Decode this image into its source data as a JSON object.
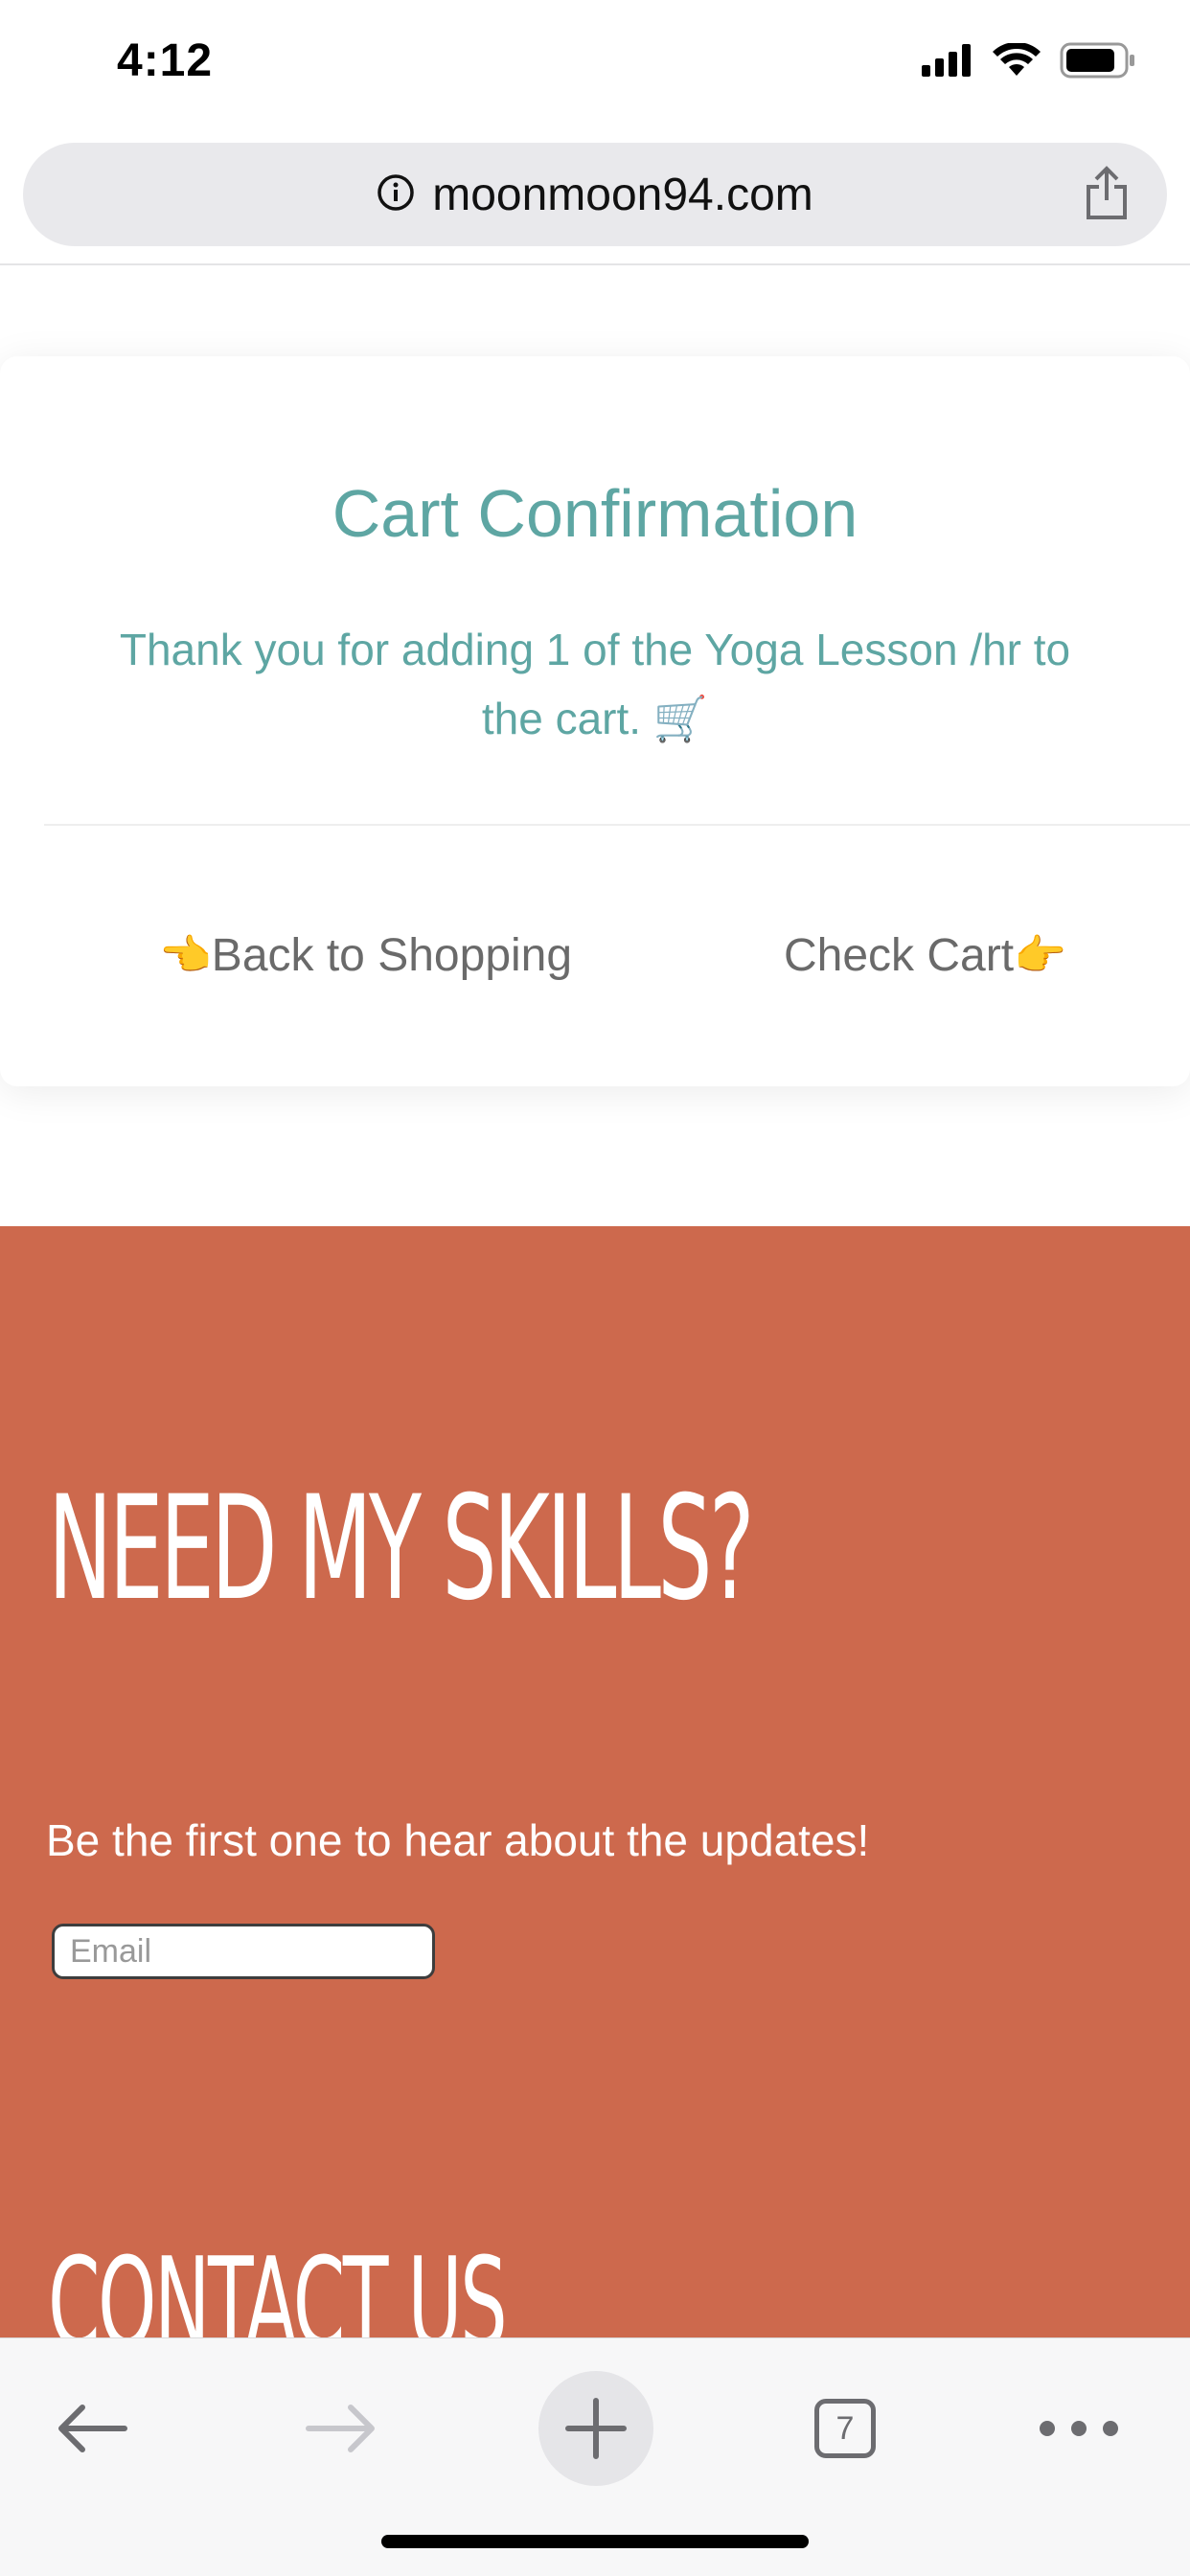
{
  "status_bar": {
    "time": "4:12"
  },
  "browser": {
    "url": "moonmoon94.com",
    "tab_count": "7"
  },
  "card": {
    "title": "Cart Confirmation",
    "message": "Thank you for adding 1 of the Yoga Lesson /hr to the cart. 🛒",
    "back_label": "Back to Shopping",
    "back_icon": "👈",
    "cart_label": "Check Cart",
    "cart_icon": "👉"
  },
  "newsletter": {
    "title": "NEED MY SKILLS?",
    "subtext": "Be the first one to hear about the updates!",
    "email_placeholder": "Email"
  },
  "contact": {
    "title": "CONTACT US"
  },
  "colors": {
    "accent_teal": "#5ea6a3",
    "section_orange": "#cd694d"
  }
}
